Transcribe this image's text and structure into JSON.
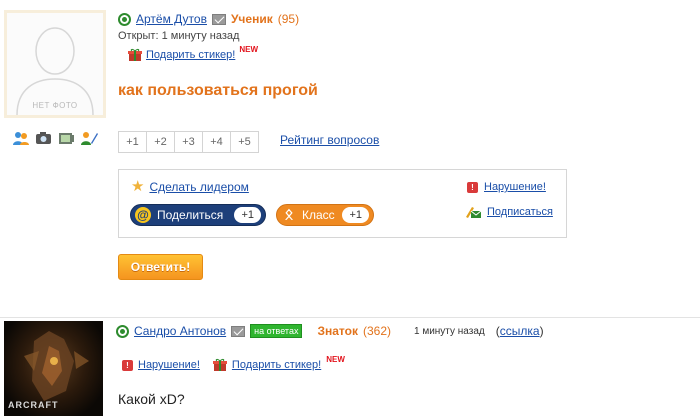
{
  "question": {
    "avatar_placeholder": "НЕТ ФОТО",
    "author": "Артём Дутов",
    "rank": "Ученик",
    "rank_score": "(95)",
    "opened": "Открыт: 1 минуту назад",
    "gift_link": "Подарить стикер!",
    "new_badge": "NEW",
    "title": "как пользоваться прогой",
    "votes": [
      "+1",
      "+2",
      "+3",
      "+4",
      "+5"
    ],
    "rating_link": "Рейтинг вопросов",
    "make_leader": "Сделать лидером",
    "report": "Нарушение!",
    "subscribe": "Подписаться",
    "share_label": "Поделиться",
    "share_count": "+1",
    "class_label": "Класс",
    "class_count": "+1",
    "answer_button": "Ответить!"
  },
  "answer": {
    "author": "Сандро Антонов",
    "online_badge": "на ответах",
    "rank": "Знаток",
    "rank_score": "(362)",
    "time": "1 минуту назад",
    "link_open": "(",
    "link_label": "ссылка",
    "link_close": ")",
    "report": "Нарушение!",
    "gift_link": "Подарить стикер!",
    "new_badge": "NEW",
    "text": "Какой xD?",
    "avatar_logo": "ARCRAFT"
  },
  "icons": {
    "agent": "agent-icon",
    "mail": "mail-icon",
    "gift": "gift-icon",
    "star": "star-icon",
    "alert": "alert-icon",
    "subscribe": "subscribe-icon"
  },
  "colors": {
    "accent_orange": "#e2731c",
    "link_blue": "#1a4ea8",
    "share_blue": "#1d3f7a",
    "class_orange": "#ef8a22",
    "online_green": "#2fb52f"
  }
}
